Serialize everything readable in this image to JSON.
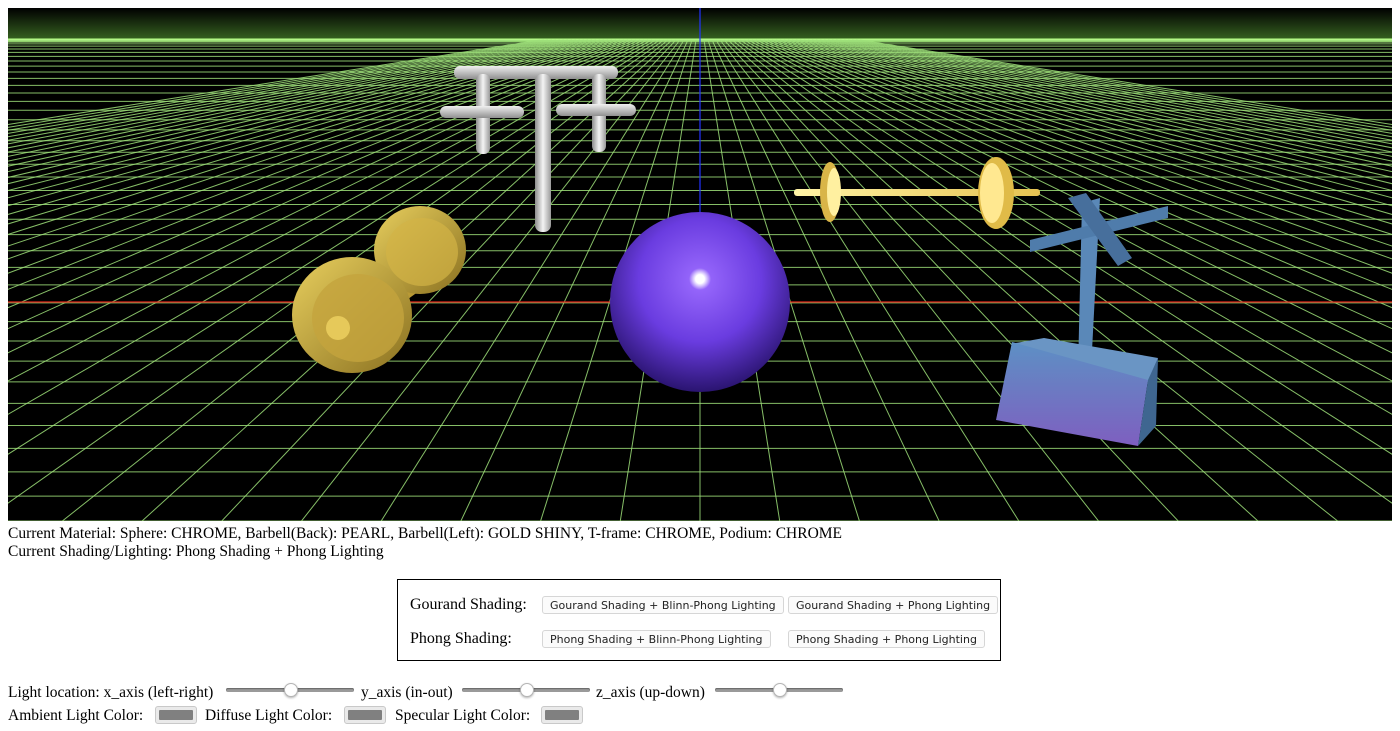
{
  "status": {
    "material_line": "Current Material: Sphere: CHROME, Barbell(Back): PEARL, Barbell(Left): GOLD SHINY, T-frame: CHROME, Podium: CHROME",
    "shading_line": "Current Shading/Lighting: Phong Shading + Phong Lighting"
  },
  "shading_panel": {
    "gourand_label": "Gourand Shading:",
    "phong_label": "Phong Shading:",
    "buttons": {
      "gourand_blinn": "Gourand Shading + Blinn-Phong Lighting",
      "gourand_phong": "Gourand Shading + Phong Lighting",
      "phong_blinn": "Phong Shading + Blinn-Phong Lighting",
      "phong_phong": "Phong Shading + Phong Lighting"
    }
  },
  "light_location": {
    "label": "Light location: x_axis (left-right)",
    "y_label": "y_axis (in-out)",
    "z_label": "z_axis (up-down)",
    "x_value": 0.5,
    "y_value": 0.5,
    "z_value": 0.5
  },
  "light_colors": {
    "ambient_label": "Ambient Light Color:",
    "diffuse_label": "Diffuse Light Color:",
    "specular_label": "Specular Light Color:",
    "ambient_value": "#808080",
    "diffuse_value": "#808080",
    "specular_value": "#808080"
  },
  "colors": {
    "grid": "#9ee07a",
    "horizon": "#b8ff8a",
    "x_axis_line": "#e0241b",
    "y_axis_line": "#2233ff",
    "sphere": "#6a3ce0",
    "gold": "#c9a93a",
    "pearl": "#ffe27a",
    "chrome": "#d8d8d8",
    "podium": "#5a88b8"
  }
}
